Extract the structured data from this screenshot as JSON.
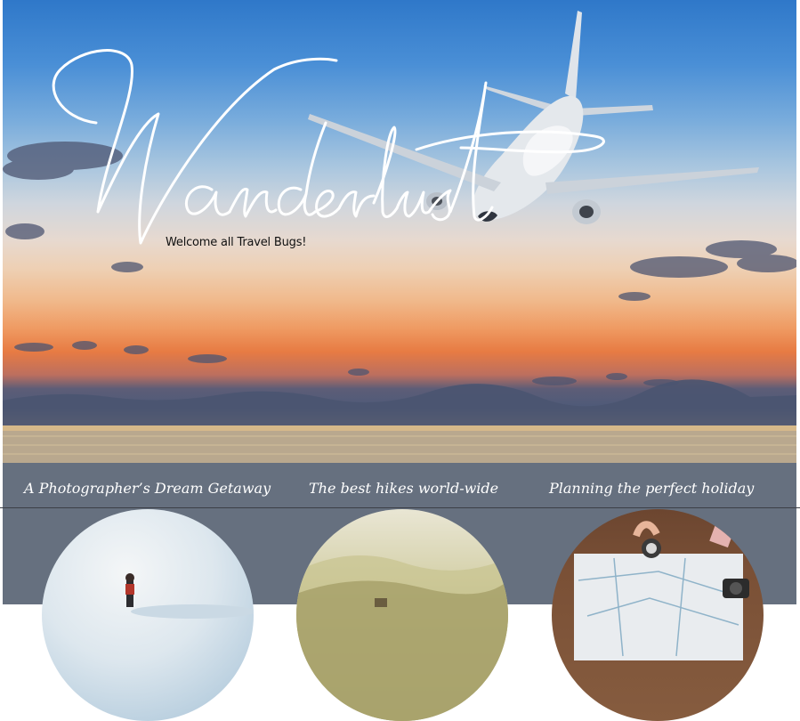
{
  "hero": {
    "title_script": "Wanderlust",
    "tagline": "Welcome all Travel Bugs!"
  },
  "nav": [
    {
      "label": "A Photographer’s Dream Getaway"
    },
    {
      "label": "The best hikes world-wide"
    },
    {
      "label": "Planning the perfect holiday"
    }
  ],
  "colors": {
    "strip": "#66707f",
    "nav_text": "#ffffff",
    "sky_top": "#2f78c9",
    "sunset_orange": "#e77b43"
  }
}
